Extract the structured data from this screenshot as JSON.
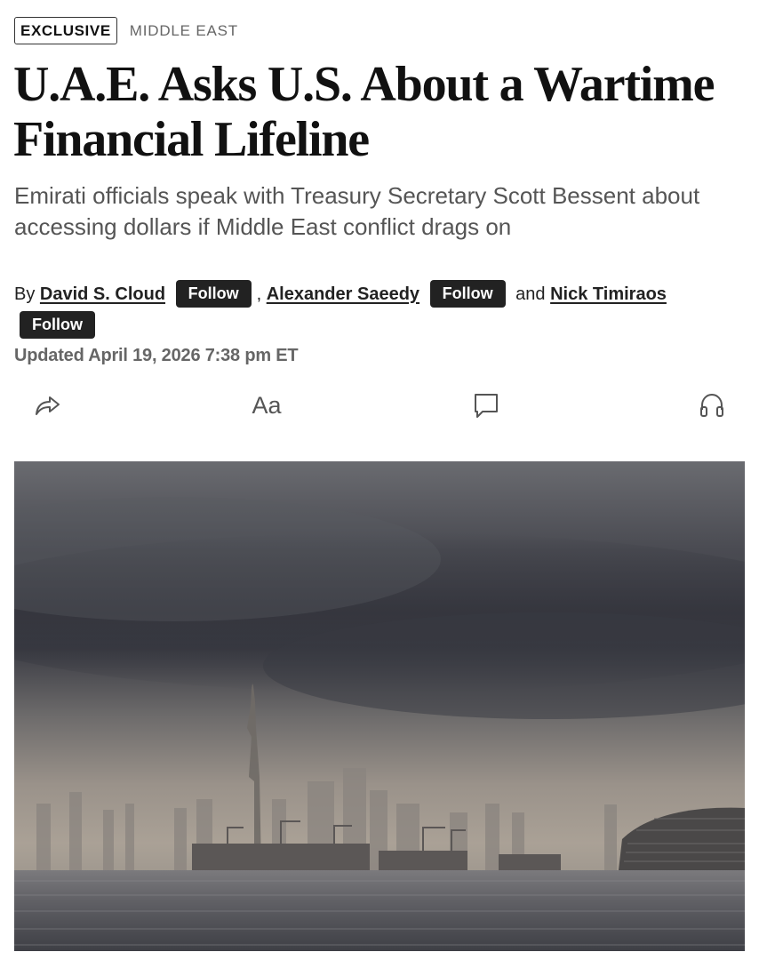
{
  "tags": {
    "exclusive": "EXCLUSIVE",
    "section": "MIDDLE EAST"
  },
  "headline": "U.A.E. Asks U.S. About a Wartime Financial Lifeline",
  "dek": "Emirati officials speak with Treasury Secretary Scott Bessent about accessing dollars if Middle East conflict drags on",
  "byline": {
    "prefix": "By",
    "authors": [
      "David S. Cloud",
      "Alexander Saeedy",
      "Nick Timiraos"
    ],
    "follow_label": "Follow",
    "separator": ",",
    "and": "and"
  },
  "updated": "Updated April 19, 2026 7:38 pm ET",
  "toolbar": {
    "share_icon": "share-icon",
    "text_size_label": "Aa",
    "comment_icon": "comment-icon",
    "listen_icon": "headphones-icon"
  },
  "hero_image": {
    "subject": "hazy-city-skyline-under-storm-clouds"
  },
  "colors": {
    "text": "#111111",
    "dek": "#555555",
    "meta": "#666666",
    "button": "#222222"
  }
}
